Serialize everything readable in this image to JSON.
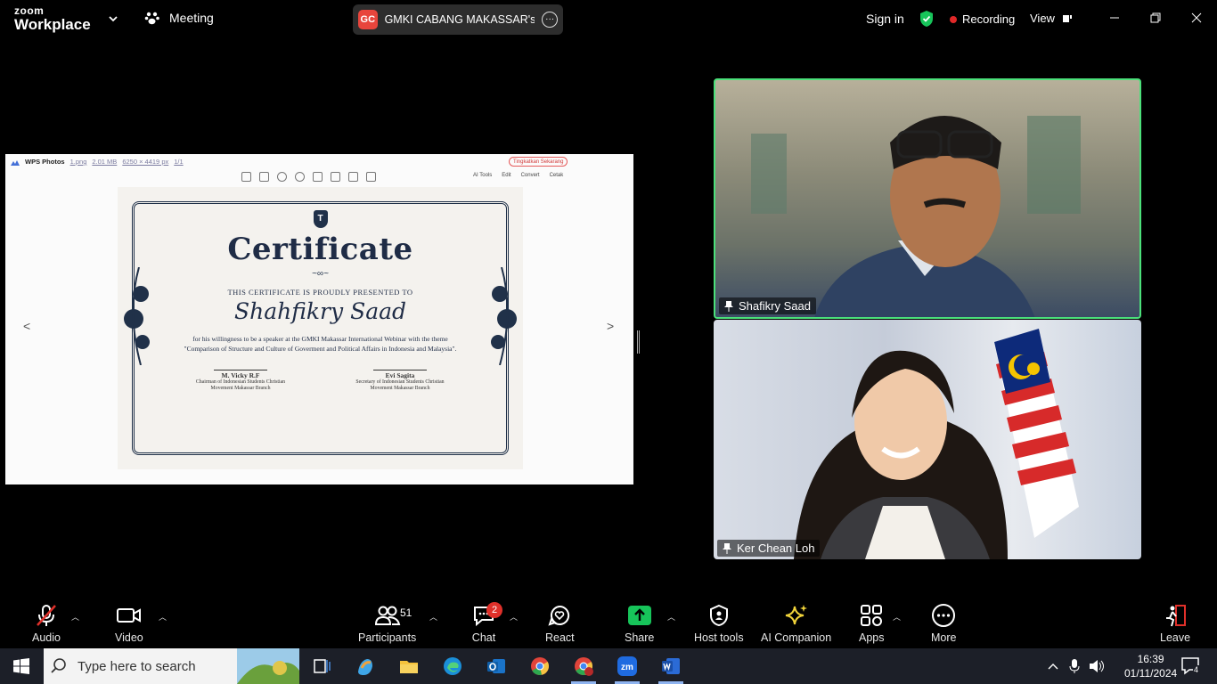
{
  "topbar": {
    "brand_top": "zoom",
    "brand_bottom": "Workplace",
    "meeting_label": "Meeting",
    "share_badge": "GC",
    "share_title": "GMKI CABANG MAKASSAR's scr",
    "signin": "Sign in",
    "recording": "Recording",
    "view": "View"
  },
  "shared_screen": {
    "app_name": "WPS Photos",
    "file_name": "1.png",
    "file_size": "2.01 MB",
    "dimensions": "6250 × 4419 px",
    "page": "1/1",
    "upgrade": "Tingkatkan Sekarang",
    "tools": {
      "ai": "AI Tools",
      "edit": "Edit",
      "convert": "Convert",
      "print": "Cetak"
    },
    "certificate": {
      "logo": "T",
      "title": "Certificate",
      "presented": "THIS CERTIFICATE IS PROUDLY PRESENTED TO",
      "name": "Shahfikry Saad",
      "body": "for his willingness to be a speaker at the GMKI Makassar International Webinar with the theme \"Comparison of Structure and Culture of Goverment and Political Affairs in Indonesia and Malaysia\".",
      "sig1_name": "M. Vicky R.F",
      "sig1_role": "Chairman of Indonesian Students Christian Movement Makassar Branch",
      "sig2_name": "Evi Sagita",
      "sig2_role": "Secretary of Indonesian Students Christian Movement Makassar Branch"
    }
  },
  "participants_video": [
    {
      "name": "Shafikry Saad",
      "active_speaker": true
    },
    {
      "name": "Ker Chean Loh",
      "active_speaker": false
    }
  ],
  "toolbar": {
    "audio": "Audio",
    "video": "Video",
    "participants": "Participants",
    "participants_count": "51",
    "chat": "Chat",
    "chat_badge": "2",
    "react": "React",
    "share": "Share",
    "host_tools": "Host tools",
    "ai_companion": "AI Companion",
    "apps": "Apps",
    "more": "More",
    "leave": "Leave"
  },
  "taskbar": {
    "search_placeholder": "Type here to search",
    "time": "16:39",
    "date": "01/11/2024",
    "notifications": "4"
  },
  "colors": {
    "active_speaker_border": "#4be07a",
    "recording_dot": "#e02828",
    "share_green": "#17c45a",
    "badge_red": "#e0302a"
  }
}
